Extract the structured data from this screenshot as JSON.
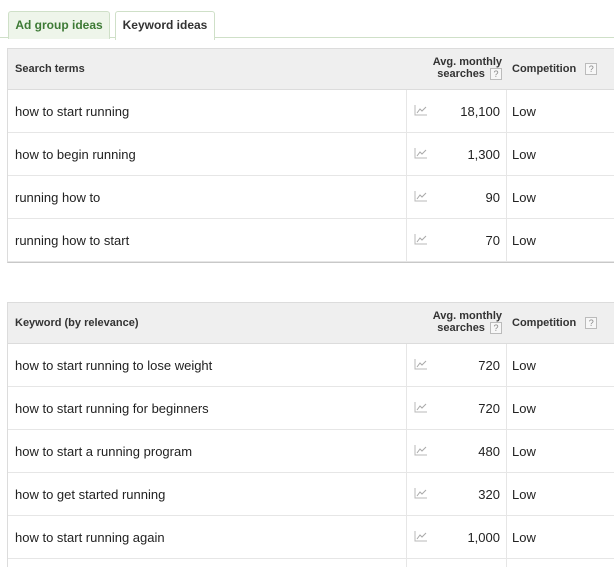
{
  "tabs": [
    {
      "label": "Ad group ideas"
    },
    {
      "label": "Keyword ideas"
    }
  ],
  "search_terms": {
    "headers": {
      "term": "Search terms",
      "avg_line1": "Avg. monthly",
      "avg_line2": "searches",
      "competition": "Competition",
      "help": "?"
    },
    "rows": [
      {
        "keyword": "how to start running",
        "searches": "18,100",
        "competition": "Low"
      },
      {
        "keyword": "how to begin running",
        "searches": "1,300",
        "competition": "Low"
      },
      {
        "keyword": "running how to",
        "searches": "90",
        "competition": "Low"
      },
      {
        "keyword": "running how to start",
        "searches": "70",
        "competition": "Low"
      }
    ]
  },
  "keyword_ideas": {
    "headers": {
      "term": "Keyword (by relevance)",
      "avg_line1": "Avg. monthly",
      "avg_line2": "searches",
      "competition": "Competition",
      "help": "?"
    },
    "rows": [
      {
        "keyword": "how to start running to lose weight",
        "searches": "720",
        "competition": "Low"
      },
      {
        "keyword": "how to start running for beginners",
        "searches": "720",
        "competition": "Low"
      },
      {
        "keyword": "how to start a running program",
        "searches": "480",
        "competition": "Low"
      },
      {
        "keyword": "how to get started running",
        "searches": "320",
        "competition": "Low"
      },
      {
        "keyword": "how to start running again",
        "searches": "1,000",
        "competition": "Low"
      }
    ]
  },
  "icons": {
    "trend": "trend-chart-icon",
    "help": "help-question-icon"
  },
  "colors": {
    "active_tab_text": "#3d7a35",
    "header_bg": "#efefef",
    "tab_border": "#cfe0c8"
  }
}
